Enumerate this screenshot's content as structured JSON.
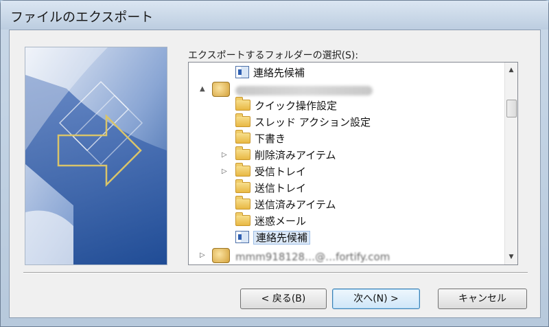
{
  "window": {
    "title": "ファイルのエクスポート"
  },
  "folder_label": "エクスポートするフォルダーの選択(S):",
  "tree": {
    "items": [
      {
        "label": "連絡先候補",
        "icon": "contacts-icon",
        "expander": ""
      },
      {
        "label": "",
        "icon": "mailbox-icon",
        "expander": "▲",
        "redacted": true
      },
      {
        "label": "クイック操作設定",
        "icon": "folder-icon",
        "expander": ""
      },
      {
        "label": "スレッド アクション設定",
        "icon": "folder-icon",
        "expander": ""
      },
      {
        "label": "下書き",
        "icon": "folder-icon",
        "expander": ""
      },
      {
        "label": "削除済みアイテム",
        "icon": "folder-icon",
        "expander": "▷"
      },
      {
        "label": "受信トレイ",
        "icon": "folder-icon",
        "expander": "▷"
      },
      {
        "label": "送信トレイ",
        "icon": "folder-icon",
        "expander": ""
      },
      {
        "label": "送信済みアイテム",
        "icon": "folder-icon",
        "expander": ""
      },
      {
        "label": "迷惑メール",
        "icon": "folder-icon",
        "expander": ""
      },
      {
        "label": "連絡先候補",
        "icon": "contacts-icon",
        "expander": "",
        "selected": true
      },
      {
        "label": "mmm918128…@…fortify.com",
        "icon": "mailbox-icon",
        "expander": "▷",
        "partial": true
      }
    ]
  },
  "scrollbar": {
    "up": "▲",
    "down": "▼"
  },
  "buttons": {
    "back": "< 戻る(B)",
    "next": "次へ(N) >",
    "cancel": "キャンセル"
  },
  "colors": {
    "accent": "#3c7fb1",
    "banner_blue": "#2c5aa0"
  }
}
